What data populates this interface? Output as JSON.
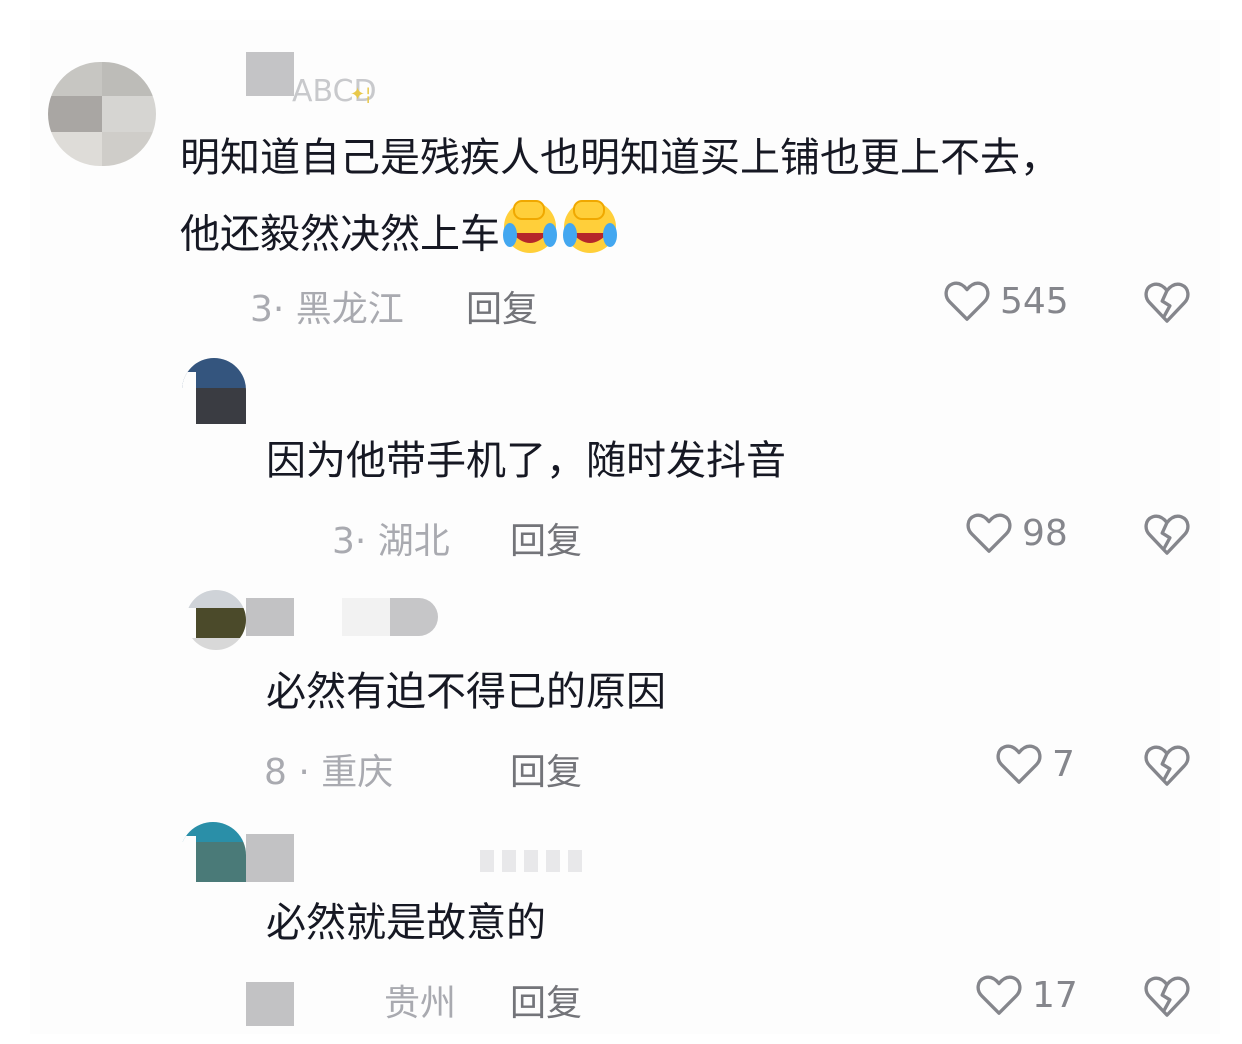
{
  "comments": [
    {
      "username": "ABCD",
      "text_line1": "明知道自己是残疾人也明知道买上铺也更上不去，",
      "text_line2": "他还毅然决然上车",
      "emoji": [
        "facepalm-crying-emoji",
        "facepalm-crying-emoji"
      ],
      "meta": "3· 黑龙江",
      "reply": "回复",
      "likes": "545"
    },
    {
      "text": "因为他带手机了，随时发抖音",
      "meta": "3· 湖北",
      "reply": "回复",
      "likes": "98"
    },
    {
      "text": "必然有迫不得已的原因",
      "meta": "8  · 重庆",
      "reply": "回复",
      "likes": "7"
    },
    {
      "text": "必然就是故意的",
      "meta": "贵州",
      "reply": "回复",
      "likes": "17"
    }
  ],
  "icons": {
    "like": "heart-outline-icon",
    "dislike": "broken-heart-icon"
  },
  "colors": {
    "text": "#161823",
    "meta": "#a9aab0",
    "reply": "#737479",
    "icon": "#85868c"
  }
}
